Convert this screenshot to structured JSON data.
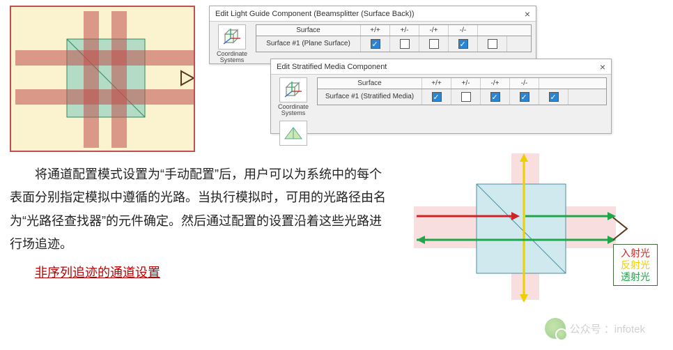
{
  "win1": {
    "title": "Edit Light Guide Component (Beamsplitter (Surface Back))",
    "iconlabel": "Coordinate\nSystems",
    "hdr_surface": "Surface",
    "hdr_cols": [
      "+/+",
      "+/-",
      "-/+",
      "-/-"
    ],
    "row_name": "Surface #1 (Plane Surface)",
    "row_checks": [
      true,
      false,
      false,
      true,
      false
    ]
  },
  "win2": {
    "title": "Edit Stratified Media Component",
    "iconlabel": "Coordinate\nSystems",
    "hdr_surface": "Surface",
    "hdr_cols": [
      "+/+",
      "+/-",
      "-/+",
      "-/-"
    ],
    "row_name": "Surface #1 (Stratified Media)",
    "row_checks": [
      true,
      false,
      true,
      true,
      true
    ]
  },
  "body_text": "　　将通道配置模式设置为“手动配置”后，用户可以为系统中的每个表面分别指定模拟中遵循的光路。当执行模拟时，可用的光路径由名为“光路径查找器”的元件确定。然后通过配置的设置沿着这些光路进行场追迹。",
  "link_text": "非序列追迹的通道设置",
  "legend": {
    "l1": "入射光",
    "l2": "反射光",
    "l3": "透射光"
  },
  "legend_colors": {
    "l1": "#d02424",
    "l2": "#ecd000",
    "l3": "#1fa64a"
  },
  "watermark": "公众号 ：infotek"
}
